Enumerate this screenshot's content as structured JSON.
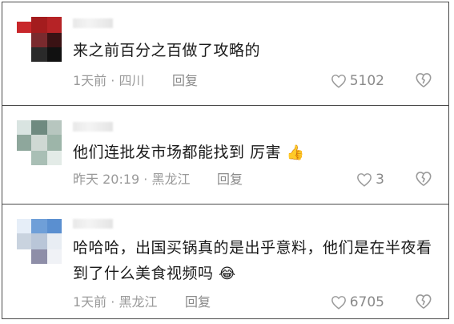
{
  "comments": [
    {
      "text": "来之前百分之百做了攻略的",
      "emoji": "",
      "time_location": "1天前 · 四川",
      "reply_label": "回复",
      "like_count": "5102"
    },
    {
      "text": "他们连批发市场都能找到 厉害",
      "emoji": "👍",
      "time_location": "昨天 20:19 · 黑龙江",
      "reply_label": "回复",
      "like_count": "3"
    },
    {
      "text": "哈哈哈，出国买锅真的是出乎意料，他们是在半夜看到了什么美食视频吗",
      "emoji": "😂",
      "time_location": "1天前 · 黑龙江",
      "reply_label": "回复",
      "like_count": "6705"
    }
  ],
  "icons": {
    "like": "heart-outline-icon",
    "dislike": "broken-heart-icon"
  },
  "colors": {
    "meta_text": "#9a9a9a",
    "comment_text": "#1a1a1a",
    "divider": "#4a4a4a"
  }
}
